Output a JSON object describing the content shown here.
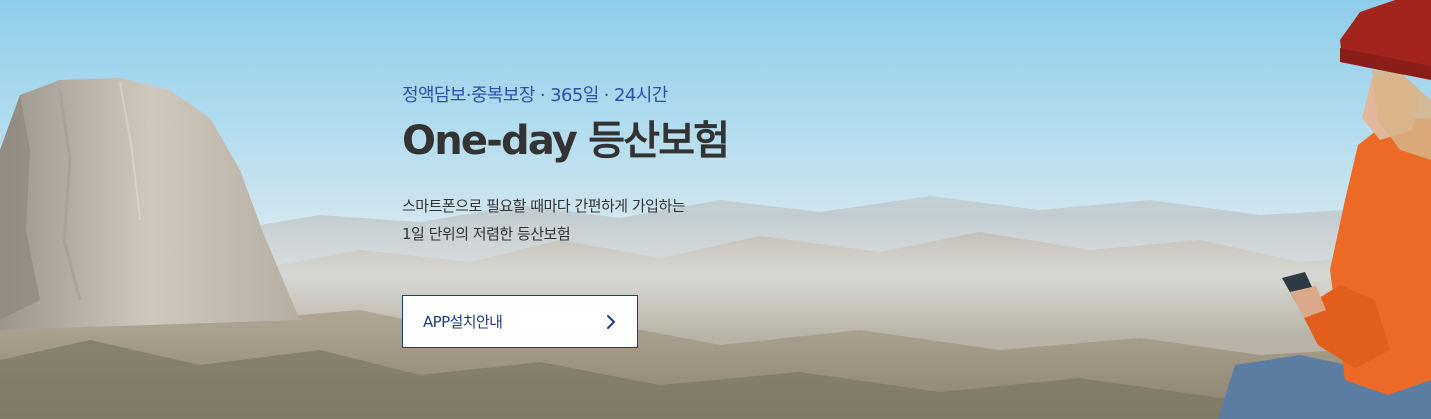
{
  "banner": {
    "tagline": "정액담보·중복보장 · 365일 · 24시간",
    "title": "One-day 등산보험",
    "description_lines": [
      "스마트폰으로 필요할 때마다 간편하게 가입하는",
      "1일 단위의 저렴한 등산보험"
    ],
    "cta_label": "APP설치안내",
    "cta_icon": "chevron-right-icon"
  },
  "colors": {
    "tagline": "#2a53a8",
    "title": "#333333",
    "button_border": "#1e3d78",
    "button_text": "#1e3d78",
    "sky": "#8fcdea",
    "jacket": "#ec6a26"
  }
}
